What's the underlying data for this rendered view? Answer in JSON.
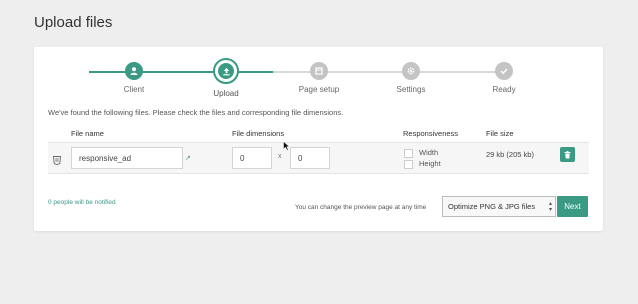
{
  "page_title": "Upload files",
  "steps": [
    {
      "label": "Client",
      "icon": "user-icon",
      "state": "done"
    },
    {
      "label": "Upload",
      "icon": "upload-icon",
      "state": "active"
    },
    {
      "label": "Page setup",
      "icon": "page-icon",
      "state": "pending"
    },
    {
      "label": "Settings",
      "icon": "gear-icon",
      "state": "pending"
    },
    {
      "label": "Ready",
      "icon": "check-icon",
      "state": "pending"
    }
  ],
  "info_text": "We've found the following files. Please check the files and corresponding file dimensions.",
  "table": {
    "headers": {
      "file_name": "File name",
      "file_dimensions": "File dimensions",
      "responsiveness": "Responsiveness",
      "file_size": "File size"
    },
    "rows": [
      {
        "file_name": "responsive_ad",
        "width": "0",
        "separator": "x",
        "height": "0",
        "resp_width_label": "Width",
        "resp_height_label": "Height",
        "file_size": "29 kb (205 kb)"
      }
    ]
  },
  "footer": {
    "notified": "0 people will be notified",
    "preview_note": "You can change the preview page at any time",
    "select_value": "Optimize PNG & JPG files",
    "next_label": "Next"
  },
  "colors": {
    "accent": "#3a9a83",
    "pending": "#c4c4c4"
  }
}
